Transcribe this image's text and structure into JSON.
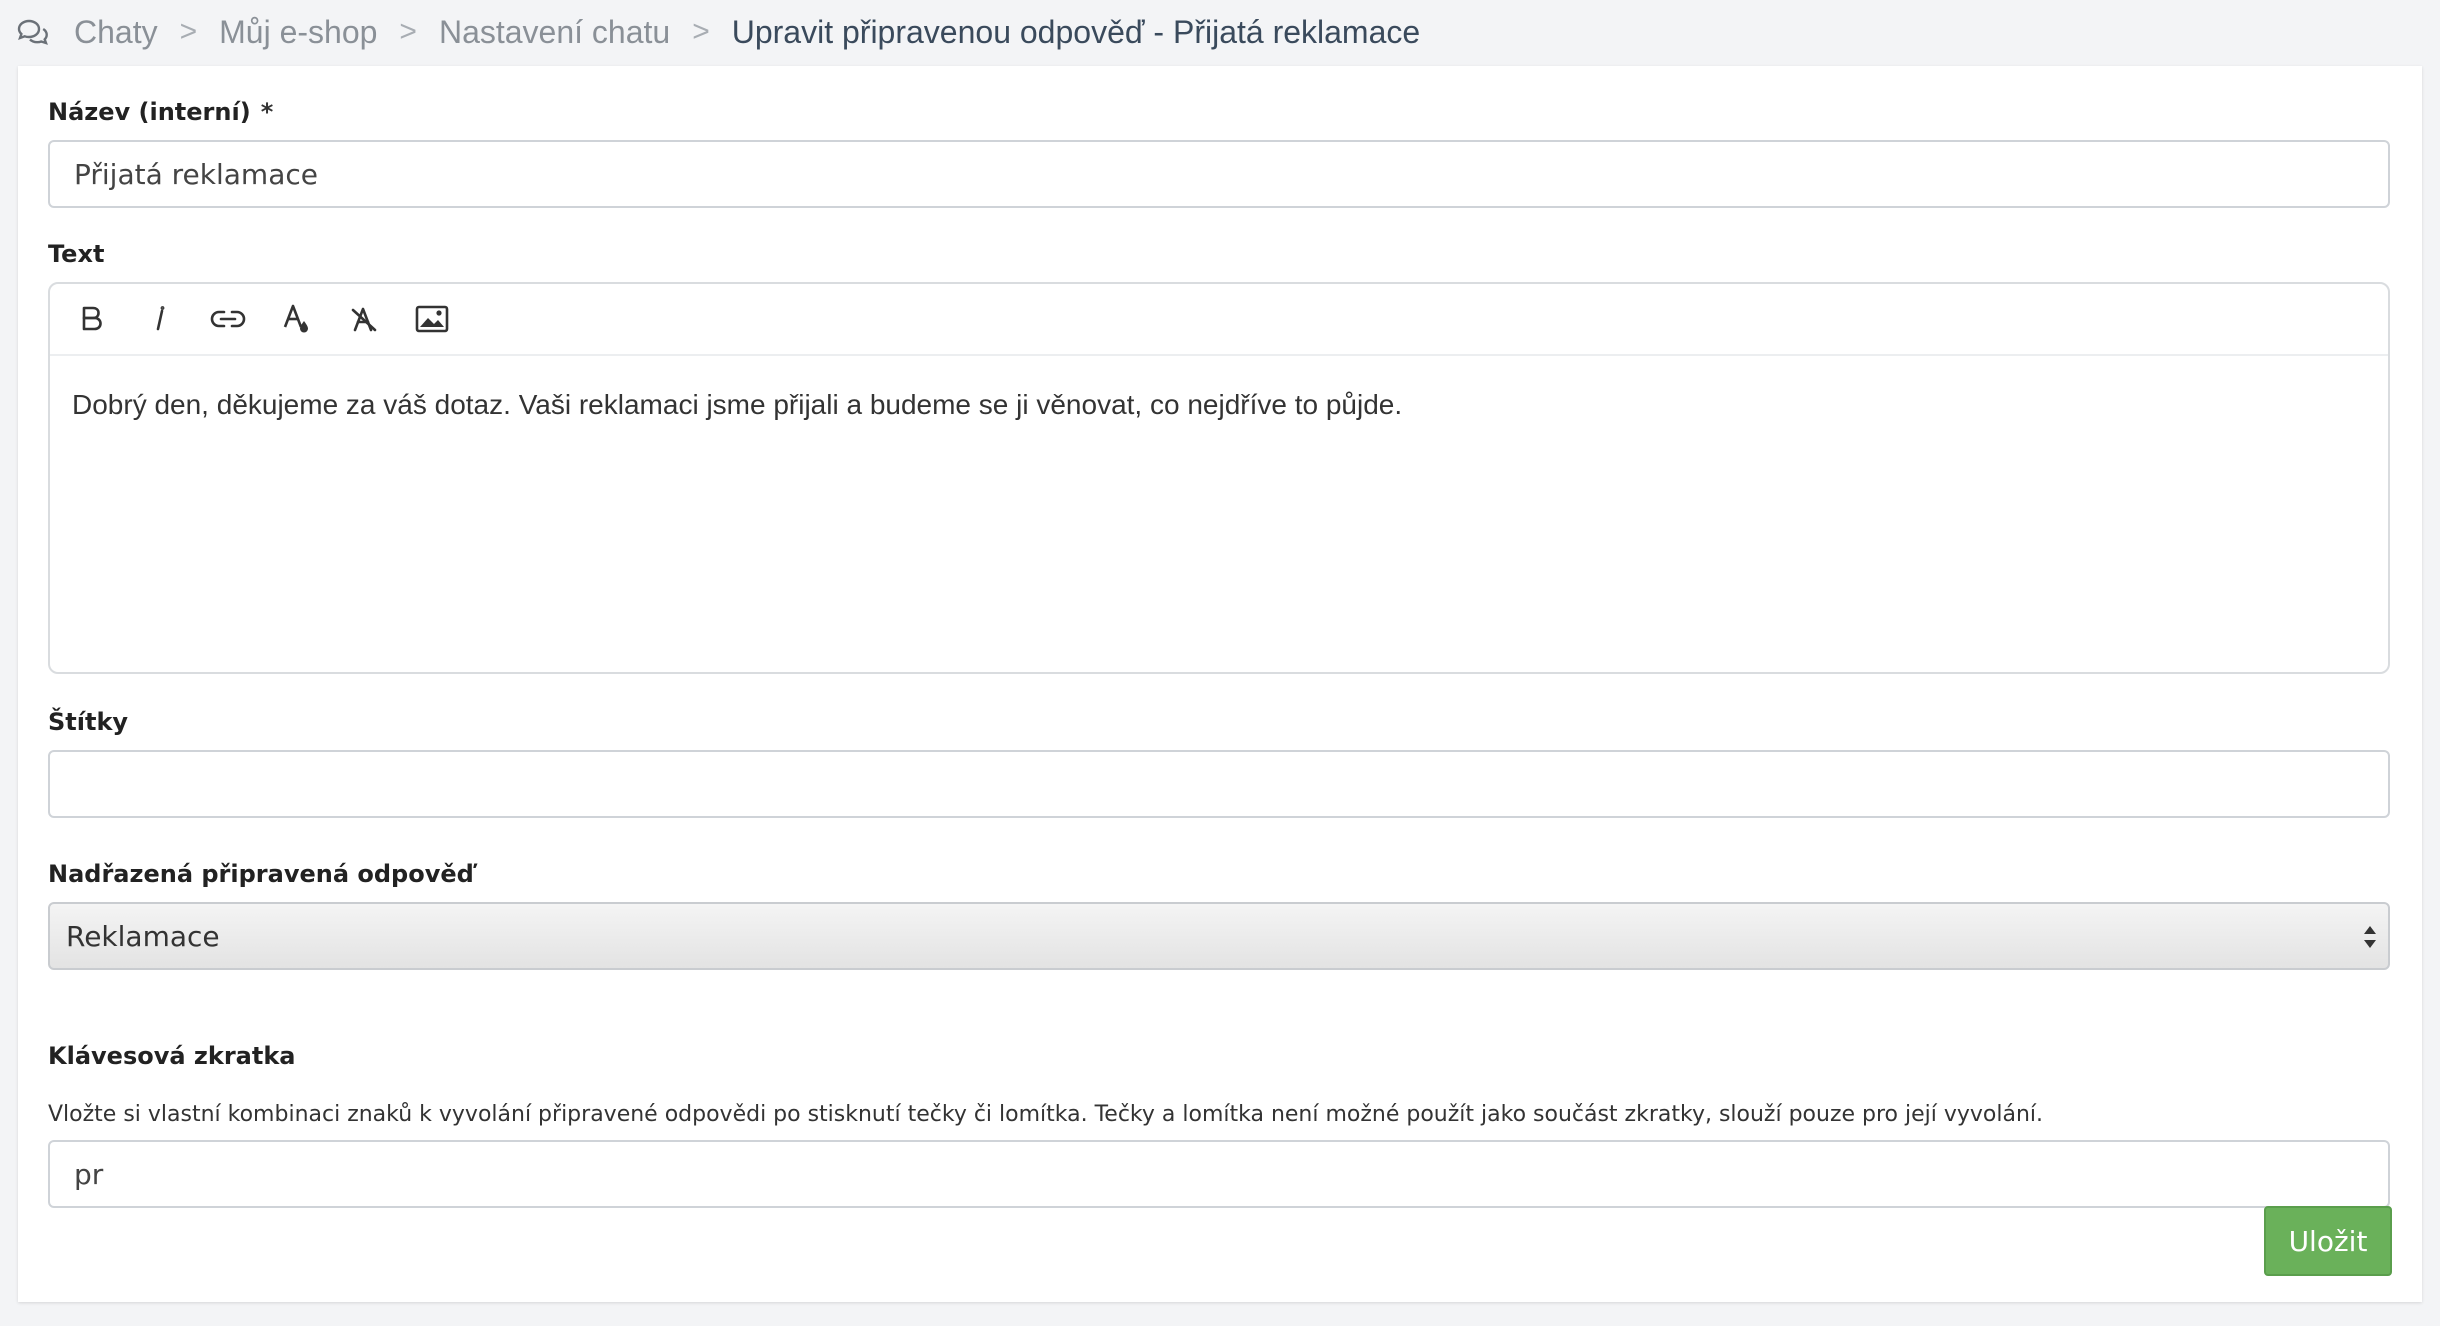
{
  "breadcrumb": {
    "icon": "chat-bubbles-icon",
    "items": [
      {
        "label": "Chaty"
      },
      {
        "label": "Můj e-shop"
      },
      {
        "label": "Nastavení chatu"
      }
    ],
    "separator": ">",
    "current": "Upravit připravenou odpověď - Přijatá reklamace"
  },
  "form": {
    "name": {
      "label": "Název (interní)",
      "required_mark": "*",
      "value": "Přijatá reklamace"
    },
    "text": {
      "label": "Text",
      "toolbar": [
        "bold-icon",
        "italic-icon",
        "link-icon",
        "text-color-icon",
        "clear-format-icon",
        "image-icon"
      ],
      "content": "Dobrý den, děkujeme za váš dotaz. Vaši reklamaci jsme přijali a budeme se ji věnovat, co nejdříve to půjde."
    },
    "tags": {
      "label": "Štítky",
      "value": ""
    },
    "parent": {
      "label": "Nadřazená připravená odpověď",
      "selected": "Reklamace"
    },
    "shortcut": {
      "label": "Klávesová zkratka",
      "help": "Vložte si vlastní kombinaci znaků k vyvolání připravené odpovědi po stisknutí tečky či lomítka. Tečky a lomítka není možné použít jako součást zkratky, slouží pouze pro její vyvolání.",
      "value": "pr"
    },
    "save_label": "Uložit"
  },
  "colors": {
    "save_button": "#6ab15a",
    "page_background": "#f3f4f6",
    "breadcrumb_current": "#3a4a5c"
  }
}
